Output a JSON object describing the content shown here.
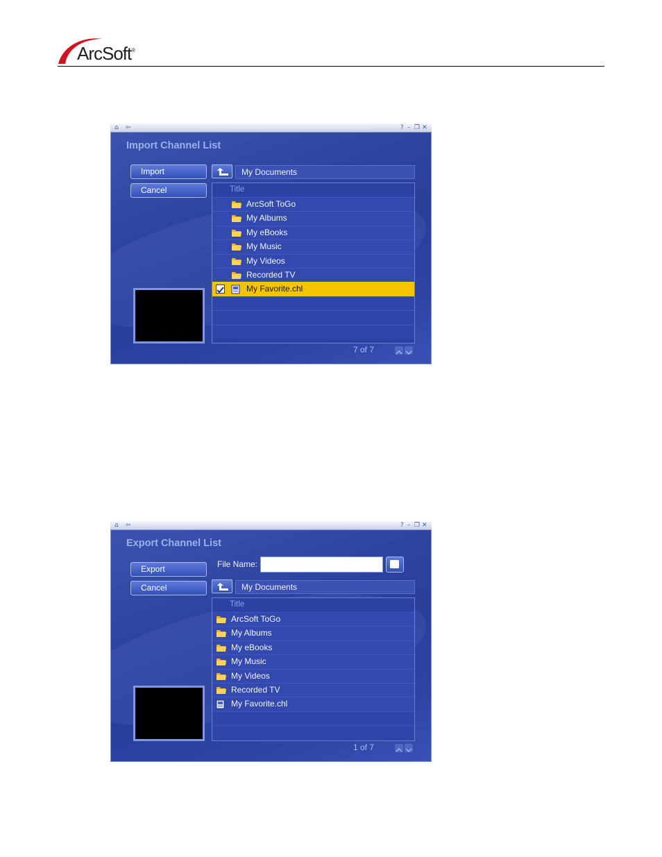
{
  "header": {
    "logo_text": "ArcSoft",
    "logo_mark": "®"
  },
  "import_dialog": {
    "title": "Import Channel List",
    "buttons": {
      "import": "Import",
      "cancel": "Cancel"
    },
    "path": "My Documents",
    "column_title": "Title",
    "items": [
      {
        "label": "ArcSoft ToGo",
        "icon": "folder-icon"
      },
      {
        "label": "My Albums",
        "icon": "folder-icon"
      },
      {
        "label": "My eBooks",
        "icon": "folder-icon"
      },
      {
        "label": "My Music",
        "icon": "folder-icon"
      },
      {
        "label": "My Videos",
        "icon": "folder-icon"
      },
      {
        "label": "Recorded TV",
        "icon": "folder-icon"
      },
      {
        "label": "My Favorite.chl",
        "icon": "channel-file-icon",
        "selected": true,
        "checked": true
      }
    ],
    "counter": "7 of 7"
  },
  "export_dialog": {
    "title": "Export Channel List",
    "buttons": {
      "export": "Export",
      "cancel": "Cancel"
    },
    "file_name_label": "File Name:",
    "file_name_value": "",
    "path": "My Documents",
    "column_title": "Title",
    "items": [
      {
        "label": "ArcSoft ToGo",
        "icon": "folder-icon"
      },
      {
        "label": "My Albums",
        "icon": "folder-icon"
      },
      {
        "label": "My eBooks",
        "icon": "folder-icon"
      },
      {
        "label": "My Music",
        "icon": "folder-icon"
      },
      {
        "label": "My Videos",
        "icon": "folder-icon"
      },
      {
        "label": "Recorded TV",
        "icon": "folder-icon"
      },
      {
        "label": "My Favorite.chl",
        "icon": "channel-file-icon"
      }
    ],
    "counter": "1 of 7"
  },
  "colors": {
    "selection": "#f5c400",
    "window": "#2f44a0",
    "title": "#9bb1ea"
  }
}
